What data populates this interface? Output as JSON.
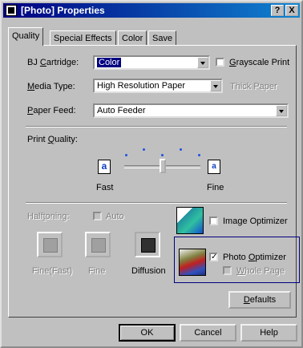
{
  "window": {
    "title": "[Photo] Properties",
    "help_btn": "?",
    "close_btn": "X"
  },
  "tabs": [
    "Quality",
    "Special Effects",
    "Color",
    "Save"
  ],
  "bj_cartridge": {
    "label_u": "BJ ",
    "label_ul": "C",
    "label_rest": "artridge:",
    "value": "Color"
  },
  "grayscale": {
    "label_u": "G",
    "label_rest": "rayscale Print"
  },
  "media_type": {
    "label_u": "M",
    "label_rest": "edia Type:",
    "value": "High Resolution Paper",
    "thick": "Thick Paper"
  },
  "paper_feed": {
    "label_u": "P",
    "label_rest": "aper Feed:",
    "value": "Auto Feeder"
  },
  "print_quality": {
    "label_a": "Print ",
    "label_u": "Q",
    "label_b": "uality:",
    "fast": "Fast",
    "fine": "Fine",
    "slider_level": 0.5
  },
  "halftoning": {
    "label_a": "Half",
    "label_u": "t",
    "label_b": "oning:",
    "auto": "Auto",
    "options": [
      "Fine(Fast)",
      "Fine",
      "Diffusion"
    ]
  },
  "image_optimizer": {
    "label": "Image Optimizer"
  },
  "photo_optimizer": {
    "label_a": "Photo ",
    "label_u": "O",
    "label_b": "ptimizer",
    "whole_a": "W",
    "whole_b": "hole Page"
  },
  "buttons": {
    "defaults_a": "D",
    "defaults_b": "efaults",
    "ok": "OK",
    "cancel": "Cancel",
    "help": "Help"
  },
  "icons": {
    "quality_glyph": "a",
    "title_icon": "printer-icon"
  }
}
